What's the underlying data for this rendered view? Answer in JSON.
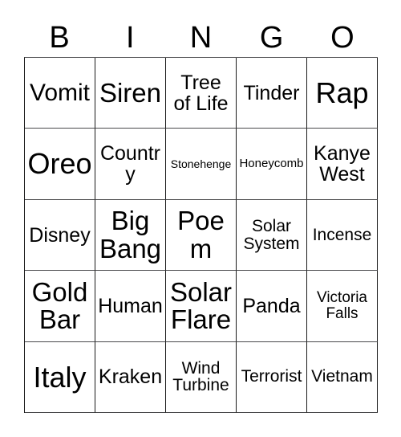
{
  "card": {
    "title": "BINGO",
    "columns": [
      "B",
      "I",
      "N",
      "G",
      "O"
    ],
    "grid_lines": {
      "border_color": "#1a1a1a",
      "cell_background": "#ffffff",
      "text_color": "#000000"
    },
    "rows": [
      {
        "cells": [
          {
            "text": "Vomit",
            "size": "l"
          },
          {
            "text": "Siren",
            "size": "xl"
          },
          {
            "text": "Tree\nof Life",
            "size": "m"
          },
          {
            "text": "Tinder",
            "size": "m"
          },
          {
            "text": "Rap",
            "size": "xxl"
          }
        ]
      },
      {
        "cells": [
          {
            "text": "Oreo",
            "size": "xxl"
          },
          {
            "text": "Country",
            "size": "m"
          },
          {
            "text": "Stonehenge",
            "size": "tiny"
          },
          {
            "text": "Honeycomb",
            "size": "xxs"
          },
          {
            "text": "Kanye\nWest",
            "size": "m"
          }
        ]
      },
      {
        "cells": [
          {
            "text": "Disney",
            "size": "m"
          },
          {
            "text": "Big\nBang",
            "size": "xl"
          },
          {
            "text": "Poem",
            "size": "xl"
          },
          {
            "text": "Solar\nSystem",
            "size": "s"
          },
          {
            "text": "Incense",
            "size": "s"
          }
        ]
      },
      {
        "cells": [
          {
            "text": "Gold\nBar",
            "size": "xl"
          },
          {
            "text": "Human",
            "size": "m"
          },
          {
            "text": "Solar\nFlare",
            "size": "xl"
          },
          {
            "text": "Panda",
            "size": "m"
          },
          {
            "text": "Victoria\nFalls",
            "size": "xs"
          }
        ]
      },
      {
        "cells": [
          {
            "text": "Italy",
            "size": "xxl"
          },
          {
            "text": "Kraken",
            "size": "m"
          },
          {
            "text": "Wind\nTurbine",
            "size": "s"
          },
          {
            "text": "Terrorist",
            "size": "s"
          },
          {
            "text": "Vietnam",
            "size": "s"
          }
        ]
      }
    ]
  }
}
